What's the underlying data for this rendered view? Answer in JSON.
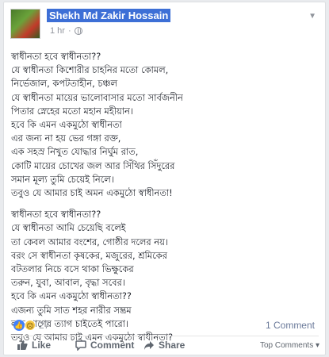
{
  "post": {
    "author": "Shekh Md Zakir Hossain",
    "time": "1 hr",
    "privacy_icon": "globe-icon",
    "paragraphs": [
      [
        "স্বাধীনতা হবে স্বাধীনতা??",
        "যে স্বাধীনতা কিশোরীর চাহনির মতো কোমল,",
        "নির্ভেজাল, কপটতাহীন, চঞ্চল",
        "যে স্বাধীনতা মায়ের ভালোবাসার মতো সার্বজনীন",
        "পিতার স্নেহের মতো মহান মহীয়ান।",
        "হবে কি এমন একমুঠো স্বাধীনতা",
        "এর জন্য না হয় ভের গঙ্গা রক্ত,",
        "এক সহস্র নিখুত যোদ্ধার নির্ঘুম রাত,",
        "কোটি মায়ের চোখের জল আর সিঁথির সিঁদুরের",
        "সমান মূল্য তুমি চেয়েই নিলে।",
        "তবুও যে আমার চাই অমন একমুঠো স্বাধীনতা!"
      ],
      [
        "স্বাধীনতা হবে স্বাধীনতা??",
        "যে স্বাধীনতা আমি চেয়েছি বলেই",
        "তা কেবল আমার বংশের, গোষ্ঠীর দলের নয়।",
        "বরং সে স্বাধীনতা কৃষকের, মজুরের, শ্রমিকের",
        "বটতলার নিচে বসে থাকা ভিক্ষুকের",
        "তরুন, যুবা, আবাল, বৃদ্ধা সবের।",
        "হবে কি এমন একমুঠো স্বাধীনতা??",
        "এজন্য তুমি সাত শহর নারীর সম্ভ্রম",
        "লক্ষ প্রাণের ত্যাগ চাইতেই পারো।",
        "তবুও যে আমার চাই এমন একমুঠো স্বাধীনতা?"
      ]
    ]
  },
  "reactions": {
    "count": "27",
    "icons": [
      "like-icon",
      "sad-icon"
    ],
    "comments_count": "1 Comment"
  },
  "actions": {
    "like": "Like",
    "comment": "Comment",
    "share": "Share",
    "top_comments": "Top Comments ▾"
  }
}
